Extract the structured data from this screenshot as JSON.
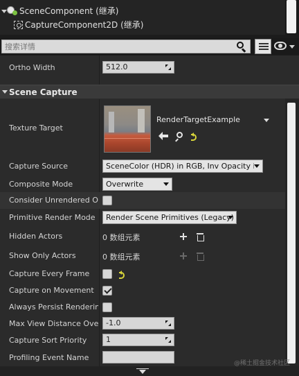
{
  "tree": {
    "items": [
      {
        "label": "SceneComponent (继承)",
        "icon": "scene-component-icon"
      },
      {
        "label": "CaptureComponent2D (继承)",
        "icon": "capture-component-icon"
      }
    ]
  },
  "search": {
    "placeholder": "搜索详情"
  },
  "ortho": {
    "label": "Ortho Width",
    "value": "512.0"
  },
  "section": {
    "title": "Scene Capture"
  },
  "props": {
    "texture_target": {
      "label": "Texture Target",
      "asset": "RenderTargetExample"
    },
    "capture_source": {
      "label": "Capture Source",
      "value": "SceneColor (HDR) in RGB, Inv Opacity in A"
    },
    "composite_mode": {
      "label": "Composite Mode",
      "value": "Overwrite"
    },
    "consider_unrendered": {
      "label": "Consider Unrendered Opacity",
      "checked": false
    },
    "primitive_render_mode": {
      "label": "Primitive Render Mode",
      "value": "Render Scene Primitives (Legacy)"
    },
    "hidden_actors": {
      "label": "Hidden Actors",
      "value": "0 数组元素"
    },
    "show_only_actors": {
      "label": "Show Only Actors",
      "value": "0 数组元素"
    },
    "capture_every_frame": {
      "label": "Capture Every Frame",
      "checked": false
    },
    "capture_on_movement": {
      "label": "Capture on Movement",
      "checked": true
    },
    "always_persist": {
      "label": "Always Persist Rendering State",
      "checked": false
    },
    "max_view_distance": {
      "label": "Max View Distance Override",
      "value": "-1.0"
    },
    "capture_sort_priority": {
      "label": "Capture Sort Priority",
      "value": "1"
    },
    "profiling_event_name": {
      "label": "Profiling Event Name",
      "value": ""
    }
  },
  "watermark": "@稀土掘金技术社区",
  "colors": {
    "reset_arrow": "#d9d63a",
    "background": "#2b2b2b",
    "section_header": "#3a3a3a"
  }
}
